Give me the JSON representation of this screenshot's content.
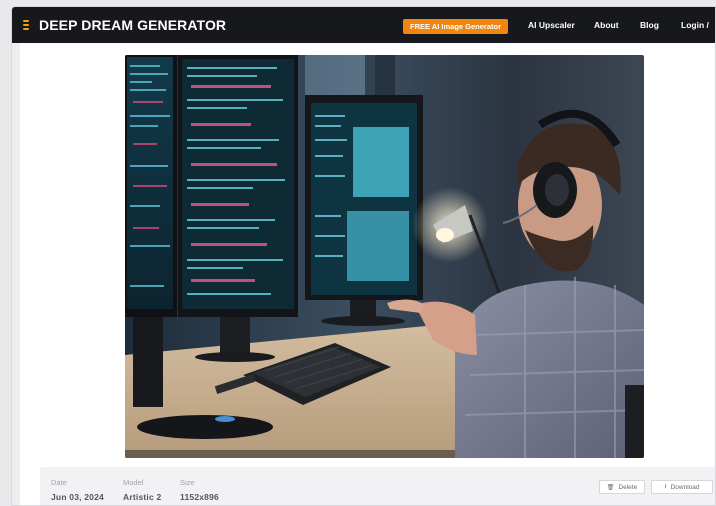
{
  "brand": {
    "name": "DEEP DREAM GENERATOR",
    "accent": "#f59a1b"
  },
  "nav": {
    "cta_label": "FREE AI Image Generator",
    "links": [
      "AI Upscaler",
      "About",
      "Blog",
      "Login /"
    ]
  },
  "artwork": {
    "scene": "man with headphones at desk with three code monitors, keyboard and desk lamp",
    "icon": "generated-image"
  },
  "meta": {
    "date_label": "Date",
    "date_value": "Jun 03, 2024",
    "model_label": "Model",
    "model_value": "Artistic 2",
    "size_label": "Size",
    "size_value": "1152x896"
  },
  "actions": {
    "delete_label": "Delete",
    "delete_icon": "trash-icon",
    "download_label": "Download",
    "download_icon": "download-icon"
  }
}
